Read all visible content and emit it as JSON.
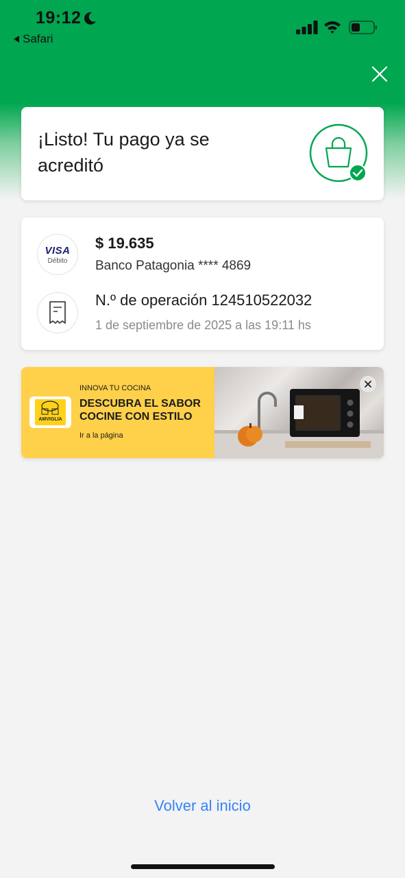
{
  "status_bar": {
    "time": "19:12",
    "back_app": "Safari"
  },
  "success": {
    "title": "¡Listo! Tu pago ya se acreditó"
  },
  "payment": {
    "card_brand": "VISA",
    "card_type": "Débito",
    "amount": "$ 19.635",
    "bank": "Banco Patagonia **** 4869",
    "operation": "N.º de operación 124510522032",
    "date": "1 de septiembre de 2025 a las 19:11 hs"
  },
  "ad": {
    "logo_text": "AMVIGLIA",
    "kicker": "INNOVA TU COCINA",
    "headline_line1": "DESCUBRA EL SABOR",
    "headline_line2": "COCINE CON ESTILO",
    "link": "Ir a la página"
  },
  "footer": {
    "home_link": "Volver al inicio"
  },
  "colors": {
    "brand_green": "#00a650",
    "link_blue": "#3483fa"
  }
}
